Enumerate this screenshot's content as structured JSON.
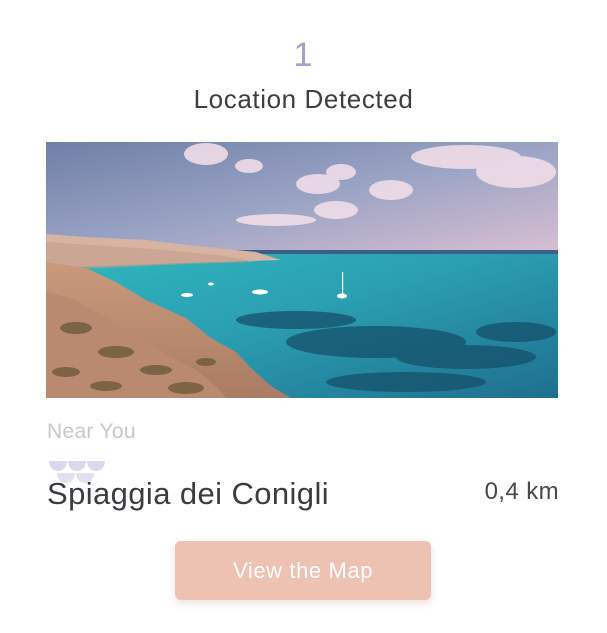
{
  "header": {
    "count": "1",
    "title": "Location Detected"
  },
  "card": {
    "photo": "coastal-bay-photo",
    "near_label": "Near You",
    "icon": "beach-wave-icon",
    "place_name": "Spiaggia dei Conigli",
    "distance": "0,4 km"
  },
  "actions": {
    "view_map_label": "View the Map"
  },
  "colors": {
    "accent_count": "#a79fc9",
    "button_bg": "#eec2b3",
    "button_text": "#ffffff",
    "muted_text": "#c9c6cc",
    "primary_text": "#3b3b40"
  }
}
